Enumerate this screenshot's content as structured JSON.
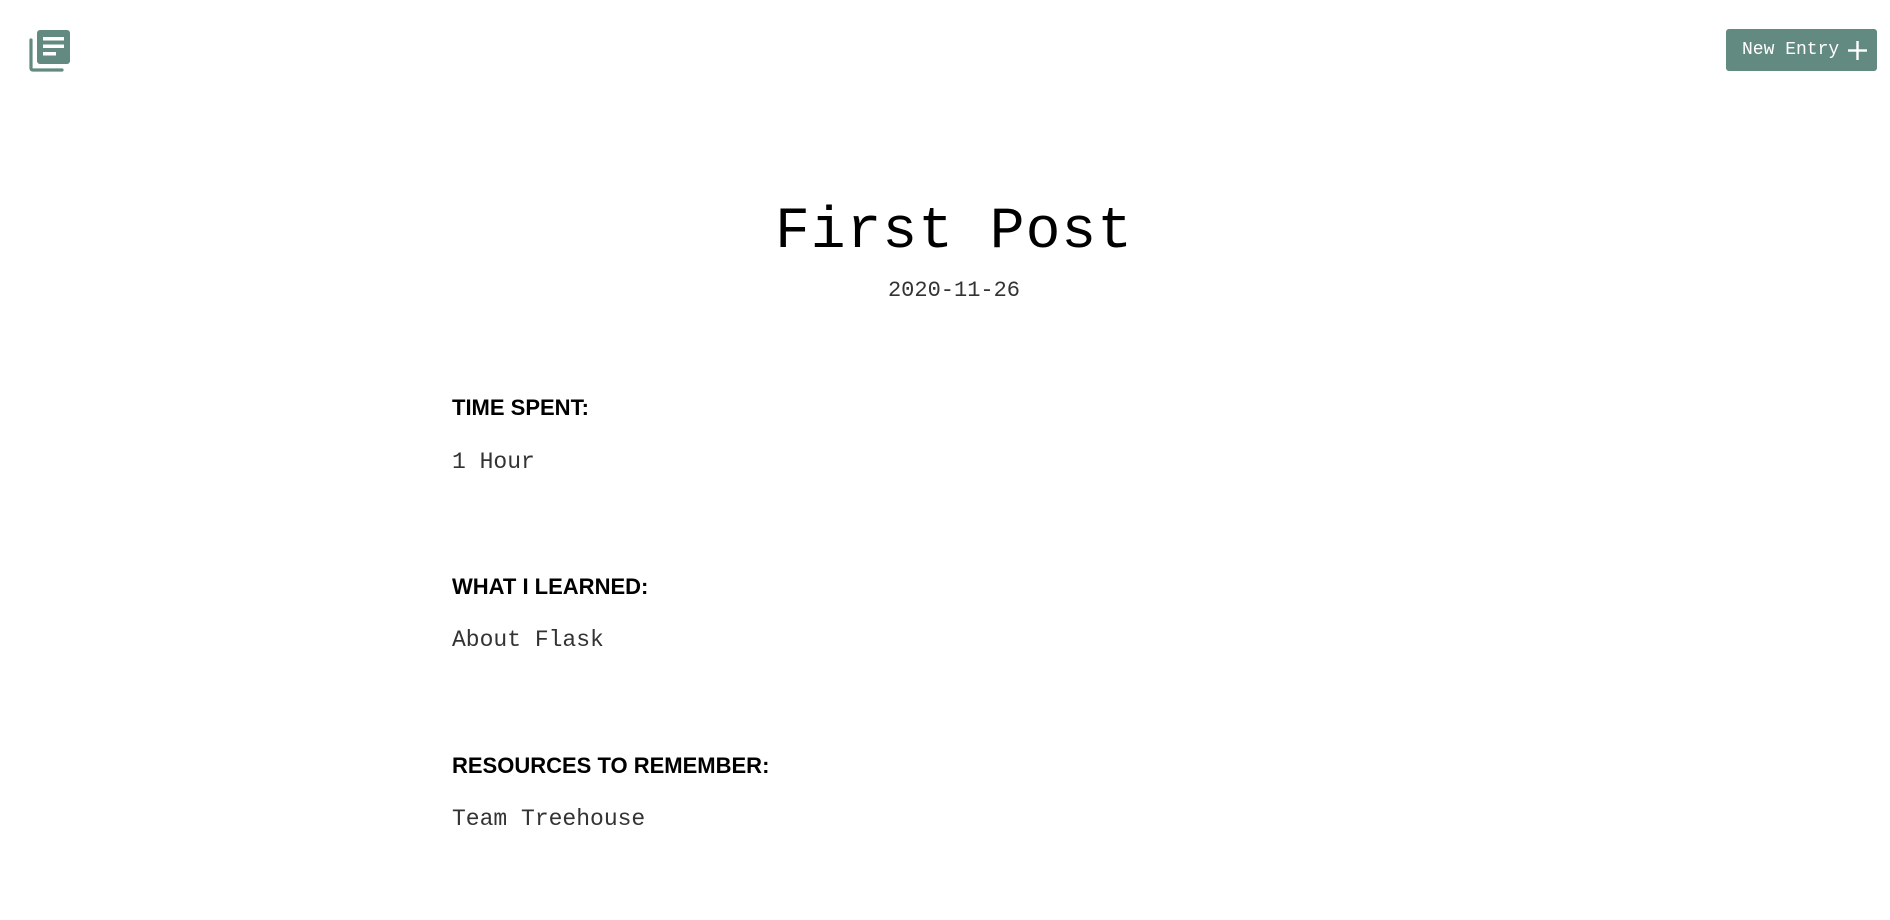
{
  "header": {
    "logo_icon": "journal-list-icon",
    "new_entry_label": "New Entry",
    "new_entry_icon": "plus-icon",
    "accent_color": "#628a81"
  },
  "entry": {
    "title": "First Post",
    "date": "2020-11-26",
    "sections": [
      {
        "label": "TIME SPENT:",
        "value": "1 Hour"
      },
      {
        "label": "WHAT I LEARNED:",
        "value": "About Flask"
      },
      {
        "label": "RESOURCES TO REMEMBER:",
        "value": "Team Treehouse"
      }
    ]
  }
}
